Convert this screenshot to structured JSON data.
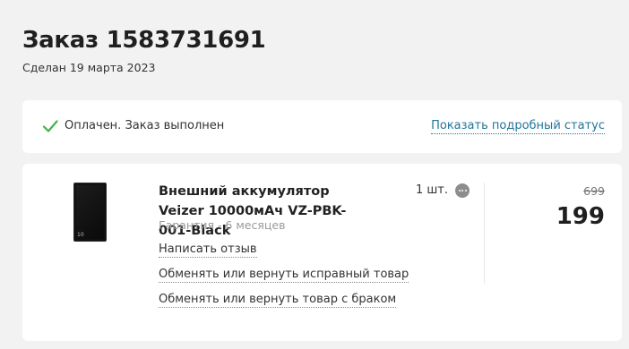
{
  "header": {
    "title": "Заказ 1583731691",
    "date": "Сделан 19 марта 2023"
  },
  "status": {
    "icon": "check-icon",
    "text": "Оплачен. Заказ выполнен",
    "link": "Показать подробный статус",
    "check_color": "#3bb54a",
    "link_color": "#21759b"
  },
  "item": {
    "image": "power-bank-image",
    "image_mark": "10",
    "name": "Внешний аккумулятор Veizer 10000мАч VZ-PBK-001-Black",
    "warranty": "Гарантия - 6 месяцев",
    "quantity": "1 шт.",
    "old_price": "699",
    "price": "199",
    "actions": {
      "review": "Написать отзыв",
      "return_ok": "Обменять или вернуть исправный товар",
      "return_defect": "Обменять или вернуть товар с браком"
    }
  }
}
